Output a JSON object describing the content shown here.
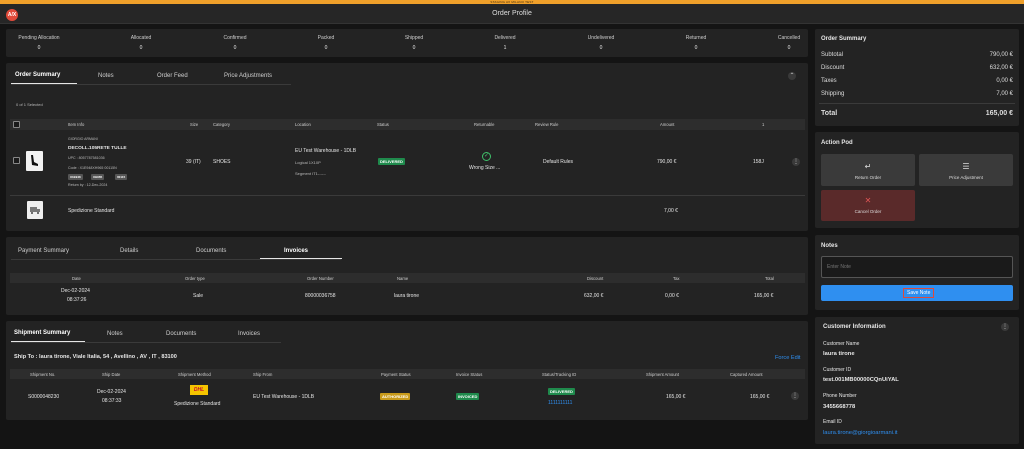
{
  "env_banner": "STAGING AX MILANO TEST",
  "header": {
    "logo_text": "A/X",
    "title": "Order Profile"
  },
  "stats": [
    {
      "label": "Pending Allocation",
      "value": "0"
    },
    {
      "label": "Allocated",
      "value": "0"
    },
    {
      "label": "Confirmed",
      "value": "0"
    },
    {
      "label": "Packed",
      "value": "0"
    },
    {
      "label": "Shipped",
      "value": "0"
    },
    {
      "label": "Delivered",
      "value": "1"
    },
    {
      "label": "Undelivered",
      "value": "0"
    },
    {
      "label": "Returned",
      "value": "0"
    },
    {
      "label": "Cancelled",
      "value": "0"
    }
  ],
  "order_tabs": [
    "Order Summary",
    "Notes",
    "Order Feed",
    "Price Adjustments"
  ],
  "selected_text": "0 of 1 Selected",
  "items_headers": [
    "Item Info",
    "Size",
    "Category",
    "Location",
    "Status",
    "Returnable",
    "Review Rule",
    "Amount",
    "1"
  ],
  "item": {
    "brand": "GIORGIO ARMANI",
    "name": "DECOLL.105RETE TULLE",
    "upc": "UPC : 8057787581036",
    "code": "Code : X1E948XH965 00115N",
    "tags": [
      "X1E948",
      "XH965",
      "00115"
    ],
    "return_by": "Return by : 12-Dec-2024",
    "size": "39 (IT)",
    "category": "SHOES",
    "location": "EU Test Warehouse - 1DLB",
    "logical": "Logical 1X10P",
    "segment": "Segment IT1------",
    "status": "DELIVERED",
    "returnable": "Wrong Size ...",
    "review_rule": "Default Rules",
    "amount": "790,00 €",
    "extra": "158J"
  },
  "shipping_line": {
    "name": "Spedizione Standard",
    "amount": "7,00 €"
  },
  "payment_tabs": [
    "Payment Summary",
    "Details",
    "Documents",
    "Invoices"
  ],
  "invoice_headers": [
    "Date",
    "Order type",
    "Order Number",
    "Name",
    "Discount",
    "Tax",
    "Total"
  ],
  "invoice_row": {
    "date": "Dec-02-2024",
    "time": "08:37:26",
    "order_type": "Sale",
    "order_number": "80000036758",
    "name": "laura tirone",
    "discount": "632,00 €",
    "tax": "0,00 €",
    "total": "165,00 €"
  },
  "shipment_tabs": [
    "Shipment Summary",
    "Notes",
    "Documents",
    "Invoices"
  ],
  "ship_to": "Ship To : laura tirone, Viale Italia, 54 , Avellino , AV , IT , 83100",
  "force_edit": "Force Edit",
  "shipment_headers": [
    "Shipment No.",
    "Ship Date",
    "Shipment Method",
    "Ship From",
    "Payment Status",
    "Invoice Status",
    "Status/Tracking ID",
    "Shipment Amount",
    "Captured Amount"
  ],
  "shipment_row": {
    "number": "S0000048230",
    "date": "Dec-02-2024",
    "time": "08:37:33",
    "carrier_logo": "DHL",
    "method": "Spedizione Standard",
    "from": "EU Test Warehouse - 1DLB",
    "payment_status": "AUTHORIZED",
    "invoice_status": "INVOICED",
    "tracking_status": "DELIVERED",
    "tracking_id": "1111111111",
    "shipment_amount": "165,00 €",
    "captured_amount": "165,00 €"
  },
  "order_summary": {
    "title": "Order Summary",
    "rows": [
      {
        "label": "Subtotal",
        "value": "790,00 €"
      },
      {
        "label": "Discount",
        "value": "632,00 €"
      },
      {
        "label": "Taxes",
        "value": "0,00 €"
      },
      {
        "label": "Shipping",
        "value": "7,00 €"
      }
    ],
    "total_label": "Total",
    "total_value": "165,00 €"
  },
  "action_pod": {
    "title": "Action Pod",
    "return": "Return Order",
    "price": "Price Adjustment",
    "cancel": "Cancel Order"
  },
  "notes": {
    "title": "Notes",
    "placeholder": "Enter Note",
    "save": "Save Note"
  },
  "customer": {
    "title": "Customer Information",
    "name_label": "Customer Name",
    "name": "laura tirone",
    "id_label": "Customer ID",
    "id": "test.001MB00000CQnUiYAL",
    "phone_label": "Phone Number",
    "phone": "3455668778",
    "email_label": "Email ID",
    "email": "laura.tirone@giorgioarmani.it"
  },
  "colors": {
    "accent": "#2f8ff0",
    "delivered": "#1f8a4c",
    "authorized": "#c89a1a",
    "cancel_bg": "#5a2a2a",
    "banner": "#f0a02a"
  }
}
